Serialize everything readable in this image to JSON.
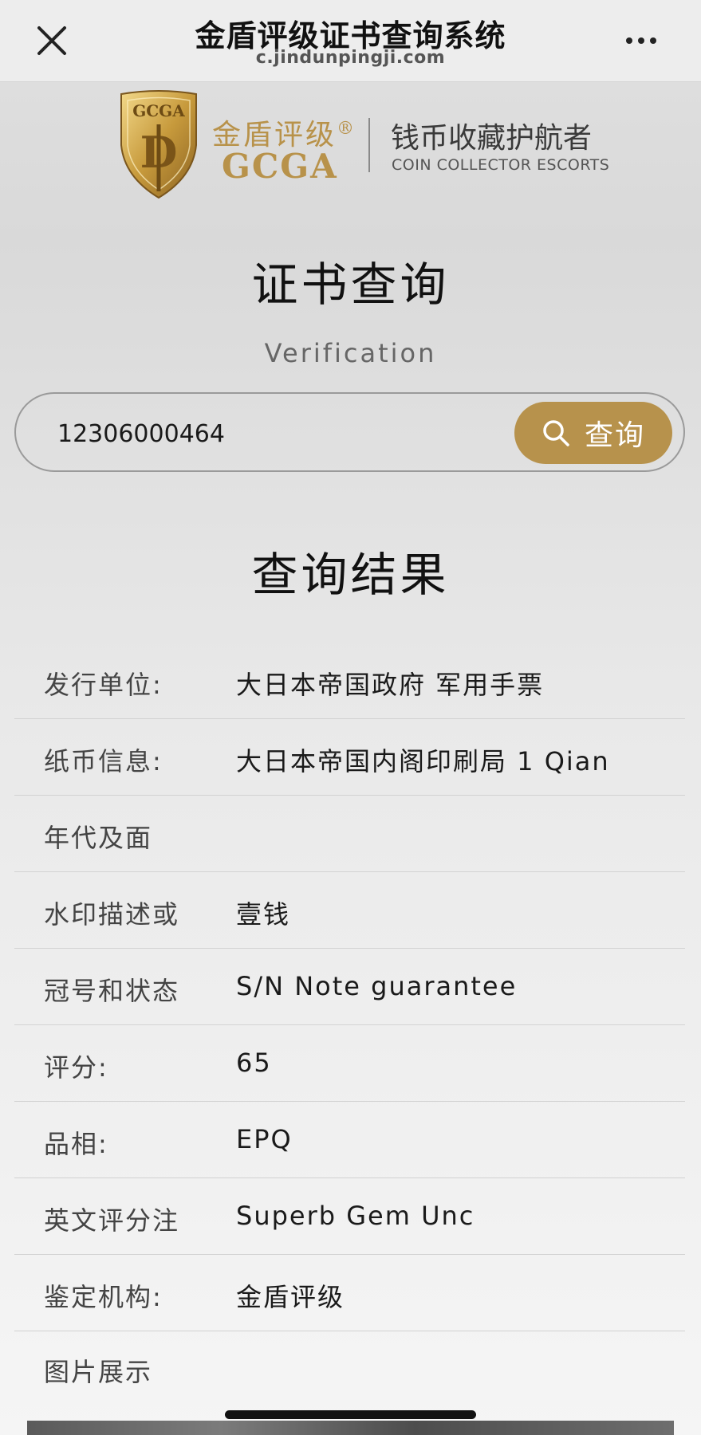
{
  "topbar": {
    "title": "金盾评级证书查询系统",
    "url": "c.jindunpingji.com"
  },
  "brand": {
    "cn_name": "金盾评级",
    "registered": "®",
    "en_name": "GCGA",
    "shield_text": "GCGA",
    "slogan_cn": "钱币收藏护航者",
    "slogan_en": "COIN COLLECTOR ESCORTS",
    "gold_color": "#b8924a"
  },
  "page": {
    "heading": "证书查询",
    "subheading": "Verification",
    "results_heading": "查询结果",
    "images_label": "图片展示"
  },
  "search": {
    "value": "12306000464",
    "button_label": "查询",
    "button_color": "#b7924c"
  },
  "results": [
    {
      "label": "发行单位:",
      "value": "大日本帝国政府 军用手票"
    },
    {
      "label": "纸币信息:",
      "value": "大日本帝国内阁印刷局 1 Qian"
    },
    {
      "label": "年代及面",
      "value": ""
    },
    {
      "label": "水印描述或",
      "value": "壹钱"
    },
    {
      "label": "冠号和状态",
      "value": "S/N Note guarantee"
    },
    {
      "label": "评分:",
      "value": "65"
    },
    {
      "label": "品相:",
      "value": "EPQ"
    },
    {
      "label": "英文评分注",
      "value": "Superb Gem Unc"
    },
    {
      "label": "鉴定机构:",
      "value": "金盾评级"
    }
  ]
}
